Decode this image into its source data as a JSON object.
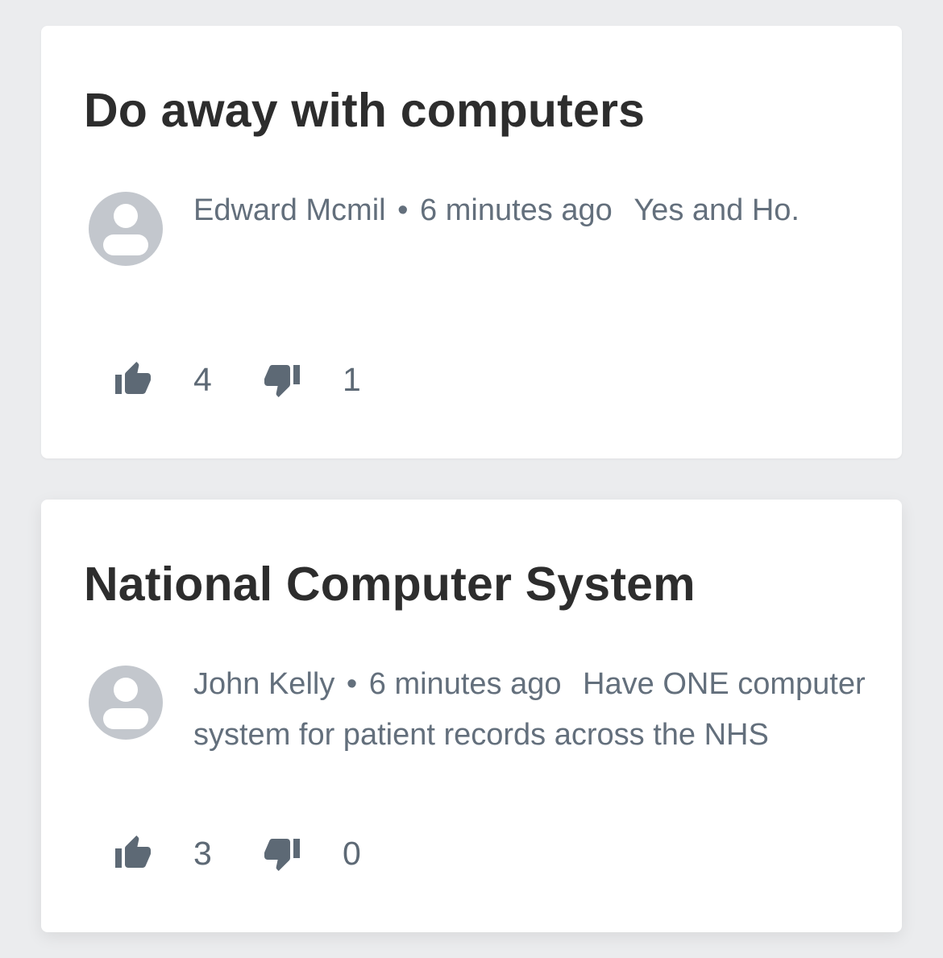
{
  "posts": [
    {
      "title": "Do away with computers",
      "author": "Edward Mcmil",
      "separator": "•",
      "time": "6 minutes ago",
      "text": "Yes and Ho.",
      "upvotes": "4",
      "downvotes": "1"
    },
    {
      "title": "National Computer System",
      "author": "John Kelly",
      "separator": "•",
      "time": "6 minutes ago",
      "text": "Have ONE computer system for patient records across the NHS",
      "upvotes": "3",
      "downvotes": "0"
    }
  ],
  "icons": {
    "avatar": "user-avatar-icon",
    "upvote": "thumbs-up-icon",
    "downvote": "thumbs-down-icon"
  },
  "colors": {
    "background": "#ebecee",
    "card": "#ffffff",
    "title": "#2d2d2d",
    "meta": "#636f7c",
    "avatar": "#c3c7cd"
  }
}
